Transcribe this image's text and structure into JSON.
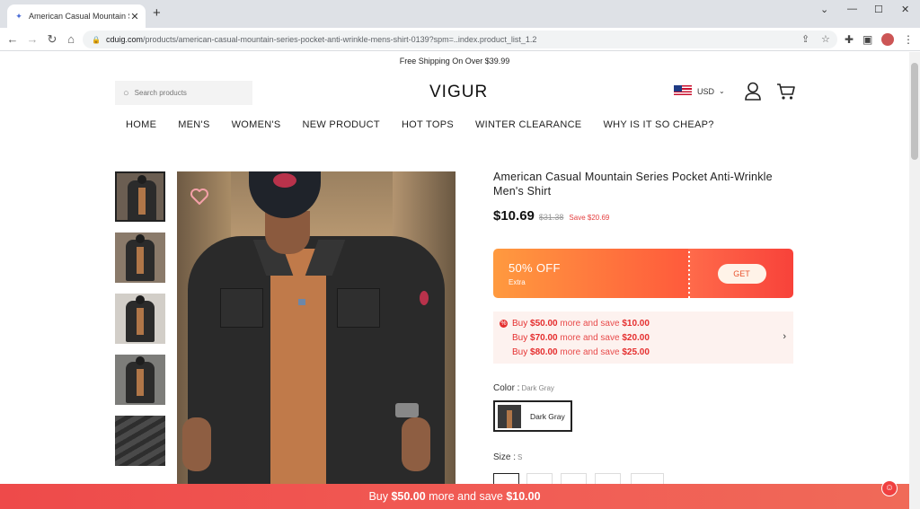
{
  "browser": {
    "tab_title": "American Casual Mountain Series",
    "tab_close": "✕",
    "new_tab": "+",
    "url_host": "cduig.com",
    "url_path": "/products/american-casual-mountain-series-pocket-anti-wrinkle-mens-shirt-0139?spm=..index.product_list_1.2",
    "window_controls": [
      "⌄",
      "—",
      "☐",
      "✕"
    ]
  },
  "site": {
    "promo_text": "Free Shipping On Over $39.99",
    "search_placeholder": "Search products",
    "logo": "VIGUR",
    "currency": "USD",
    "nav": [
      "HOME",
      "MEN'S",
      "WOMEN'S",
      "NEW PRODUCT",
      "HOT TOPS",
      "WINTER CLEARANCE",
      "WHY IS IT SO CHEAP?"
    ]
  },
  "product": {
    "title": "American Casual Mountain Series Pocket Anti-Wrinkle Men's Shirt",
    "price": "$10.69",
    "old_price": "$31.38",
    "save": "Save $20.69",
    "coupon": {
      "discount": "50% OFF",
      "sub": "Extra",
      "button": "GET"
    },
    "tiers": [
      {
        "pre": "Buy ",
        "amount": "$50.00",
        "mid": " more and save ",
        "save": "$10.00"
      },
      {
        "pre": "Buy ",
        "amount": "$70.00",
        "mid": " more and save ",
        "save": "$20.00"
      },
      {
        "pre": "Buy ",
        "amount": "$80.00",
        "mid": " more and save ",
        "save": "$25.00"
      }
    ],
    "color_label": "Color :",
    "color_value": "Dark Gray",
    "swatch_name": "Dark Gray",
    "size_label": "Size :",
    "size_value": "S"
  },
  "bottom_bar": {
    "pre": "Buy ",
    "amount": "$50.00",
    "mid": " more and save ",
    "save": "$10.00"
  },
  "colors": {
    "accent_red": "#e52f2f",
    "coupon_orange": "#ff9a3f"
  }
}
